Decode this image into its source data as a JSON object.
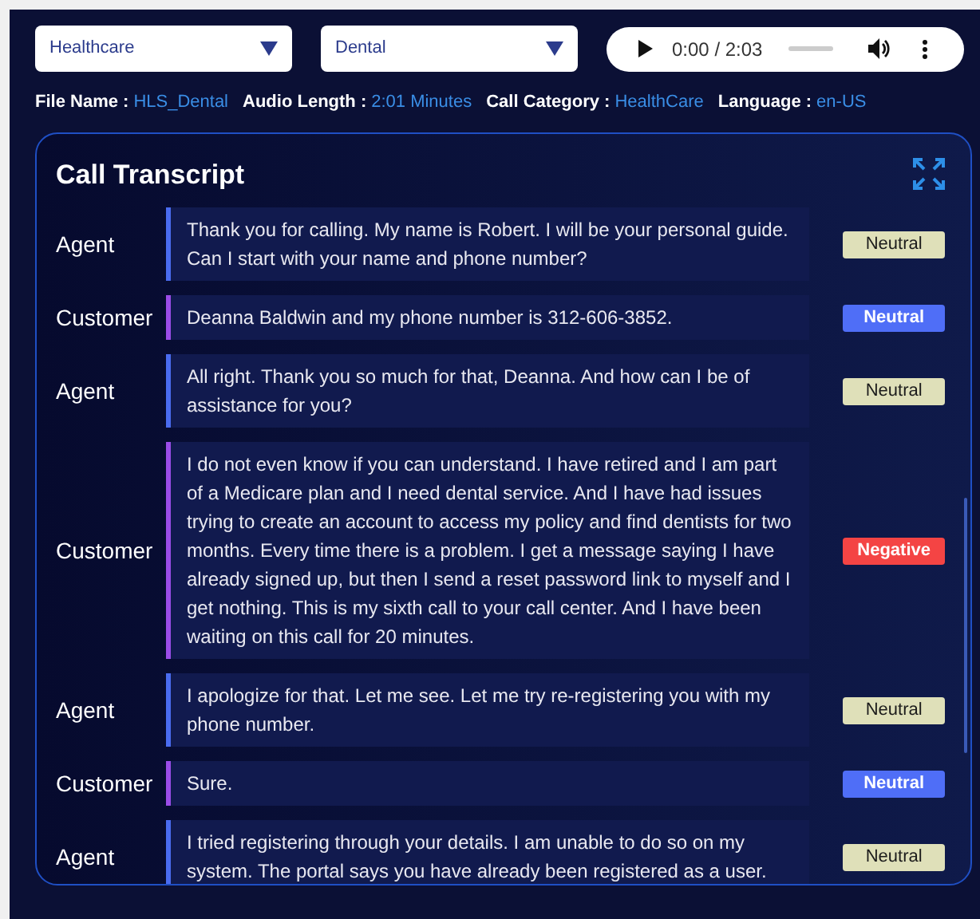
{
  "filters": [
    {
      "value": "Healthcare"
    },
    {
      "value": "Dental"
    }
  ],
  "audio": {
    "time": "0:00 / 2:03"
  },
  "info": [
    {
      "label": "File Name :",
      "value": "HLS_Dental"
    },
    {
      "label": "Audio Length :",
      "value": "2:01 Minutes"
    },
    {
      "label": "Call Category :",
      "value": "HealthCare"
    },
    {
      "label": "Language :",
      "value": "en-US"
    }
  ],
  "transcript": {
    "title": "Call Transcript",
    "rows": [
      {
        "speaker": "Agent",
        "kind": "agent",
        "text": "Thank you for calling. My name is Robert. I will be your personal guide. Can I start with your name and phone number?",
        "sentiment": "Neutral",
        "color": "#dfe0b9"
      },
      {
        "speaker": "Customer",
        "kind": "customer",
        "text": "Deanna Baldwin and my phone number is 312-606-3852.",
        "sentiment": "Neutral",
        "color": "#4f6ef7"
      },
      {
        "speaker": "Agent",
        "kind": "agent",
        "text": "All right. Thank you so much for that, Deanna. And how can I be of assistance for you?",
        "sentiment": "Neutral",
        "color": "#dfe0b9"
      },
      {
        "speaker": "Customer",
        "kind": "customer",
        "text": "I do not even know if you can understand. I have retired and I am part of a Medicare plan and I need dental service. And I have had issues trying to create an account to access my policy and find dentists for two months. Every time there is a problem. I get a message saying I have already signed up, but then I send a reset password link to myself and I get nothing. This is my sixth call to your call center. And I have been waiting on this call for 20 minutes.",
        "sentiment": "Negative",
        "color": "#f44444"
      },
      {
        "speaker": "Agent",
        "kind": "agent",
        "text": "I apologize for that. Let me see. Let me try re-registering you with my phone number.",
        "sentiment": "Neutral",
        "color": "#dfe0b9"
      },
      {
        "speaker": "Customer",
        "kind": "customer",
        "text": "Sure.",
        "sentiment": "Neutral",
        "color": "#4f6ef7"
      },
      {
        "speaker": "Agent",
        "kind": "agent",
        "text": "I tried registering through your details. I am unable to do so on my system. The portal says you have already been registered as a user.",
        "sentiment": "Neutral",
        "color": "#dfe0b9"
      }
    ]
  }
}
